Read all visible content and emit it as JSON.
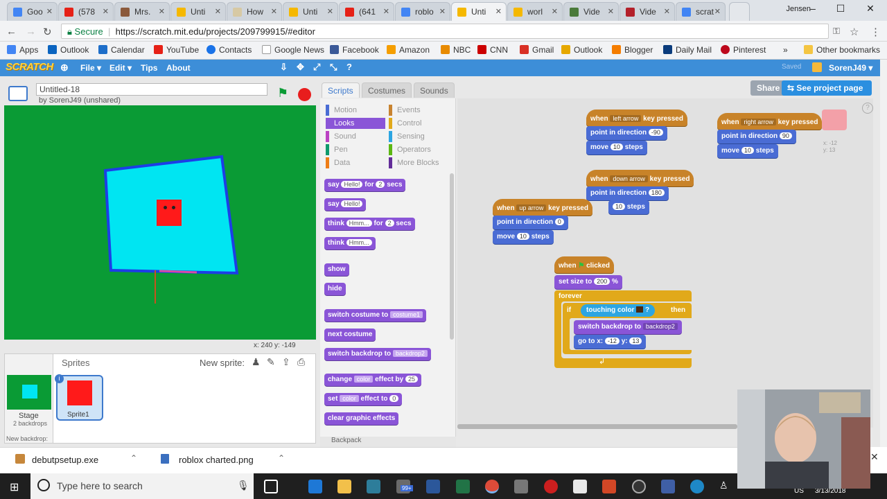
{
  "browser": {
    "tabs": [
      {
        "label": "Goo",
        "color": "#4285f4"
      },
      {
        "label": "(578",
        "color": "#e62117"
      },
      {
        "label": "Mrs.",
        "color": "#8b5a3c"
      },
      {
        "label": "Unti",
        "color": "#f5b800"
      },
      {
        "label": "How",
        "color": "#d7c9a4"
      },
      {
        "label": "Unti",
        "color": "#f5b800"
      },
      {
        "label": "(641",
        "color": "#e62117"
      },
      {
        "label": "roblo",
        "color": "#4285f4"
      },
      {
        "label": "Unti",
        "color": "#f5b800"
      },
      {
        "label": "worl",
        "color": "#f5b800"
      },
      {
        "label": "Vide",
        "color": "#4a7a3a"
      },
      {
        "label": "Vide",
        "color": "#b3202a"
      },
      {
        "label": "scrat",
        "color": "#4285f4"
      }
    ],
    "user": "Jensen",
    "secure_label": "Secure",
    "url": "https://scratch.mit.edu/projects/209799915/#editor",
    "bookmarks": [
      {
        "label": "Apps",
        "color": "#4285f4"
      },
      {
        "label": "Outlook",
        "color": "#0b64c0"
      },
      {
        "label": "Calendar",
        "color": "#1e6ec9"
      },
      {
        "label": "YouTube",
        "color": "#e62117"
      },
      {
        "label": "Contacts",
        "color": "#1a73e8"
      },
      {
        "label": "Google News",
        "color": "#4285f4"
      },
      {
        "label": "Facebook",
        "color": "#3b5998"
      },
      {
        "label": "Amazon",
        "color": "#f59e00"
      },
      {
        "label": "NBC",
        "color": "#e88a00"
      },
      {
        "label": "CNN",
        "color": "#cc0000"
      },
      {
        "label": "Gmail",
        "color": "#d93025"
      },
      {
        "label": "Outlook",
        "color": "#e6a800"
      },
      {
        "label": "Blogger",
        "color": "#f57d00"
      },
      {
        "label": "Daily Mail",
        "color": "#0b3c7c"
      },
      {
        "label": "Pinterest",
        "color": "#bd081c"
      }
    ],
    "more_bookmarks": "»",
    "other_bookmarks": "Other bookmarks"
  },
  "scratch": {
    "logo": "SCRATCH",
    "menu": {
      "file": "File ▾",
      "edit": "Edit ▾",
      "tips": "Tips",
      "about": "About"
    },
    "saved": "Saved",
    "username": "SorenJ49 ▾",
    "project_title": "Untitled-18",
    "byline": "by SorenJ49 (unshared)",
    "tabs": {
      "scripts": "Scripts",
      "costumes": "Costumes",
      "sounds": "Sounds"
    },
    "share": "Share",
    "see_project": "See project page",
    "coords": "x: 240   y: -149",
    "sprites_title": "Sprites",
    "new_sprite": "New sprite:",
    "stage_label": "Stage",
    "stage_sub": "2 backdrops",
    "new_backdrop": "New backdrop:",
    "sprite1": "Sprite1",
    "backpack": "Backpack",
    "categories": {
      "motion": "Motion",
      "looks": "Looks",
      "sound": "Sound",
      "pen": "Pen",
      "data": "Data",
      "events": "Events",
      "control": "Control",
      "sensing": "Sensing",
      "operators": "Operators",
      "more": "More Blocks"
    },
    "palette": {
      "say_for": "say",
      "hello": "Hello!",
      "for": "for",
      "secs": "secs",
      "two": "2",
      "say": "say",
      "think_for": "think",
      "hmm": "Hmm...",
      "think": "think",
      "show": "show",
      "hide": "hide",
      "switch_costume": "switch costume to",
      "costume1": "costume1",
      "next_costume": "next costume",
      "switch_backdrop": "switch backdrop to",
      "backdrop2": "backdrop2",
      "change": "change",
      "color": "color",
      "effect_by": "effect by",
      "twentyfive": "25",
      "set": "set",
      "effect_to": "effect to",
      "zero": "0",
      "clear": "clear graphic effects"
    },
    "scripts": {
      "when": "when",
      "key_pressed": "key pressed",
      "left_arrow": "left arrow",
      "right_arrow": "right arrow",
      "down_arrow": "down arrow",
      "up_arrow": "up arrow",
      "point_in_direction": "point in direction",
      "dir_left": "-90",
      "dir_right": "90",
      "dir_down": "180",
      "dir_up": "0",
      "move": "move",
      "steps": "steps",
      "ten": "10",
      "clicked": "clicked",
      "set_size": "set size to",
      "size": "200",
      "percent": "%",
      "forever": "forever",
      "if": "if",
      "touching_color": "touching color",
      "question": "?",
      "then": "then",
      "switch_backdrop": "switch backdrop to",
      "backdrop2": "backdrop2",
      "go_to": "go to x:",
      "gx": "-12",
      "y": "y:",
      "gy": "13",
      "sprite_x": "x: -12",
      "sprite_y": "y: 13"
    }
  },
  "downloads": {
    "item1": "debutpsetup.exe",
    "item2": "roblox charted.png"
  },
  "taskbar": {
    "search": "Type here to search",
    "badge": "99+",
    "lang": "US",
    "date": "3/13/2018"
  }
}
